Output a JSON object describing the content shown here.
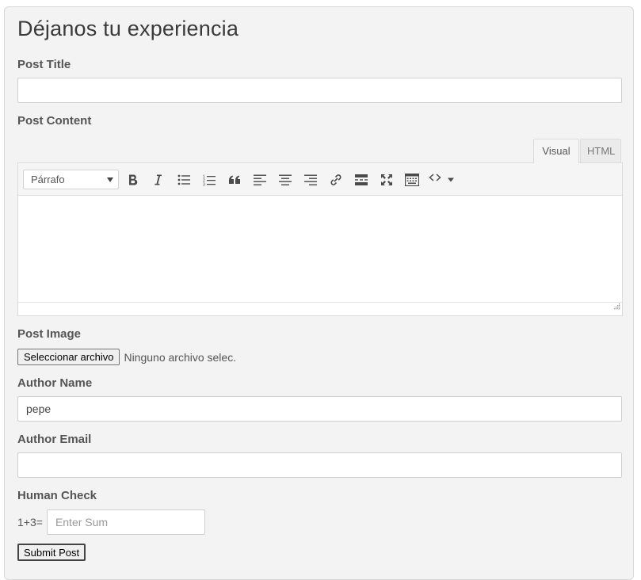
{
  "form": {
    "title": "Déjanos tu experiencia",
    "post_title": {
      "label": "Post Title",
      "value": ""
    },
    "post_content": {
      "label": "Post Content",
      "tabs": {
        "visual": "Visual",
        "html": "HTML"
      },
      "format_select": "Párrafo",
      "toolbar_icons": [
        "bold-icon",
        "italic-icon",
        "bullet-list-icon",
        "numbered-list-icon",
        "blockquote-icon",
        "align-left-icon",
        "align-center-icon",
        "align-right-icon",
        "link-icon",
        "read-more-icon",
        "fullscreen-icon",
        "toolbar-toggle-icon",
        "code-icon"
      ]
    },
    "post_image": {
      "label": "Post Image",
      "button": "Seleccionar archivo",
      "status": "Ninguno archivo selec."
    },
    "author_name": {
      "label": "Author Name",
      "value": "pepe"
    },
    "author_email": {
      "label": "Author Email",
      "value": ""
    },
    "human_check": {
      "label": "Human Check",
      "equation": "1+3=",
      "placeholder": "Enter Sum"
    },
    "submit": "Submit Post"
  }
}
